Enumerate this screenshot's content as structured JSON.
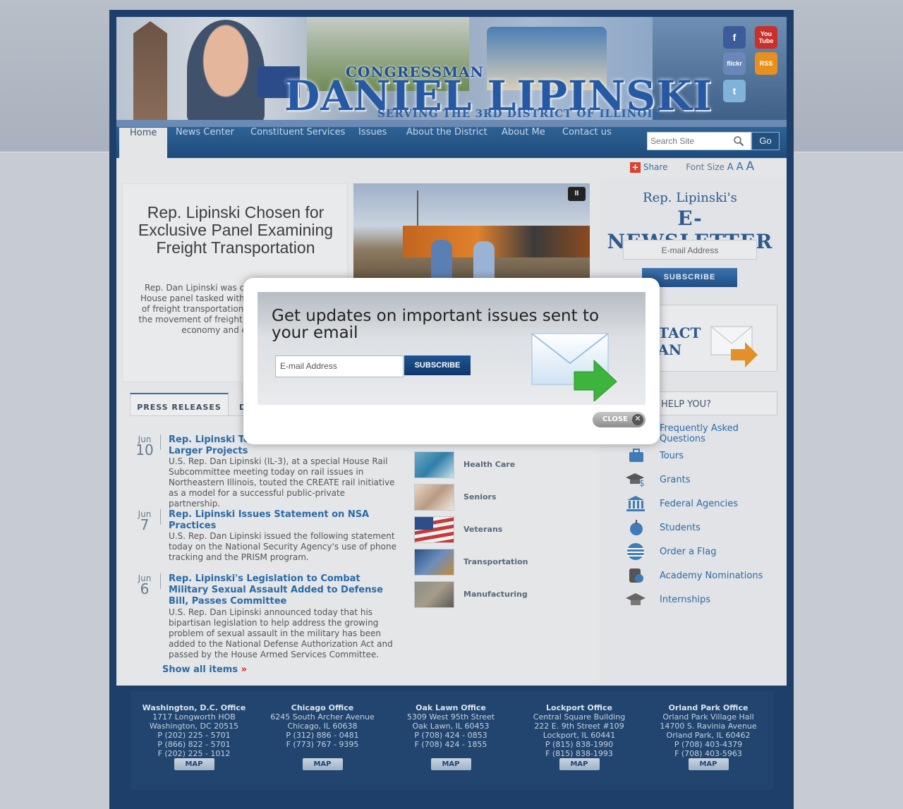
{
  "banner": {
    "congressman": "CONGRESSMAN",
    "name": "DANIEL LIPINSKI",
    "serving": "SERVING THE 3RD DISTRICT OF ILLINOIS"
  },
  "social": {
    "facebook": "f",
    "youtube": "You Tube",
    "flickr": "flickr",
    "rss": "RSS",
    "twitter": "t"
  },
  "nav": {
    "items": [
      "Home",
      "News Center",
      "Constituent Services",
      "Issues",
      "About the District",
      "About Me",
      "Contact us"
    ],
    "active": "Home"
  },
  "search": {
    "placeholder": "Search Site",
    "go": "Go"
  },
  "tools": {
    "share": "Share",
    "font_size": "Font Size",
    "a_small": "A",
    "a_med": "A",
    "a_large": "A"
  },
  "feature": {
    "title": "Rep. Lipinski Chosen for Exclusive Panel Examining Freight Transportation",
    "text": "Rep. Dan Lipinski was chosen to serve on a House panel tasked with examining the state of freight transportation and how to improve the movement of freight to better support the economy and create jobs.",
    "pause": "II"
  },
  "tabs": {
    "press_releases": "PRESS RELEASES",
    "second": "D"
  },
  "press": [
    {
      "month": "Jun",
      "day": "10",
      "title": "Rep. Lipinski Touts Federal Commitment to Larger Projects",
      "text": "U.S. Rep. Dan Lipinski (IL-3), at a special House Rail Subcommittee meeting today on rail issues in Northeastern Illinois, touted the CREATE rail initiative as a model for a successful public-private partnership."
    },
    {
      "month": "Jun",
      "day": "7",
      "title": "Rep. Lipinski Issues Statement on NSA Practices",
      "text": "U.S. Rep. Dan Lipinski issued the following statement today on the National Security Agency's use of phone tracking and the PRISM program."
    },
    {
      "month": "Jun",
      "day": "6",
      "title": "Rep. Lipinski's Legislation to Combat Military Sexual Assault Added to Defense Bill, Passes Committee",
      "text": "U.S. Rep. Dan Lipinski announced today that his bipartisan legislation to help address the growing problem of sexual assault in the military has been added to the National Defense Authorization Act and passed by the House Armed Services Committee."
    }
  ],
  "show_all": "Show all items",
  "issues": [
    "Health Care",
    "Seniors",
    "Veterans",
    "Transportation",
    "Manufacturing"
  ],
  "enews": {
    "title1": "Rep. Lipinski's",
    "title2": "E-NEWSLETTER",
    "placeholder": "E-mail Address",
    "subscribe": "SUBSCRIBE"
  },
  "contact": {
    "line1": "NTACT",
    "line2": "DAN"
  },
  "help": {
    "title": "I HELP YOU?",
    "links": [
      "Frequently Asked Questions",
      "Tours",
      "Grants",
      "Federal Agencies",
      "Students",
      "Order a Flag",
      "Academy Nominations",
      "Internships"
    ]
  },
  "offices": [
    {
      "name": "Washington, D.C. Office",
      "lines": [
        "1717 Longworth HOB",
        "Washington, DC 20515",
        "P (202) 225 - 5701",
        "P (866) 822 - 5701",
        "F (202) 225 - 1012"
      ],
      "map": "MAP"
    },
    {
      "name": "Chicago Office",
      "lines": [
        "6245 South Archer Avenue",
        "Chicago, IL 60638",
        "P (312) 886 - 0481",
        "F (773) 767 - 9395"
      ],
      "map": "MAP"
    },
    {
      "name": "Oak Lawn Office",
      "lines": [
        "5309 West 95th Street",
        "Oak Lawn, IL 60453",
        "P (708) 424 - 0853",
        "F (708) 424 - 1855"
      ],
      "map": "MAP"
    },
    {
      "name": "Lockport Office",
      "lines": [
        "Central Square Building",
        "222 E. 9th Street #109",
        "Lockport, IL 60441",
        "P (815) 838-1990",
        "F (815) 838-1993"
      ],
      "map": "MAP"
    },
    {
      "name": "Orland Park Office",
      "lines": [
        "Orland Park Village Hall",
        "14700 S. Ravinia Avenue",
        "Orland Park, IL 60462",
        "P (708) 403-4379",
        "F (708) 403-5963"
      ],
      "map": "MAP"
    }
  ],
  "modal": {
    "heading": "Get updates on important issues sent to your email",
    "placeholder": "E-mail Address",
    "subscribe": "SUBSCRIBE",
    "close": "CLOSE",
    "close_x": "✕"
  }
}
